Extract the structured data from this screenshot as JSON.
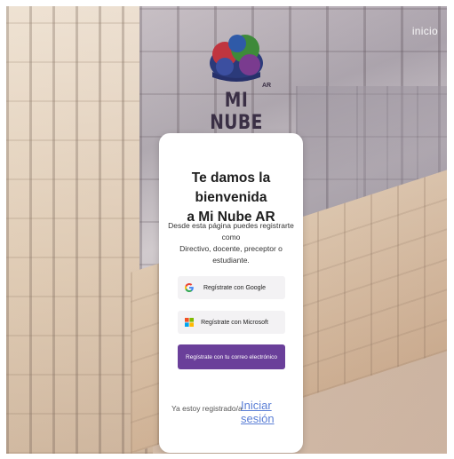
{
  "header": {
    "inicio_label": "inicio"
  },
  "logo": {
    "text": "MI NUBE",
    "sub": "AR"
  },
  "card": {
    "title_line1": "Te damos la bienvenida",
    "title_line2": "a Mi Nube AR",
    "subtitle_line1": "Desde esta página puedes registrarte como",
    "subtitle_line2": "Directivo, docente, preceptor o estudiante.",
    "google_button": "Regístrate con Google",
    "microsoft_button": "Regístrate con Microsoft",
    "email_button": "Regístrate con tu correo electrónico",
    "already_registered": "Ya estoy registrado/a",
    "login_link": "Iniciar sesión"
  },
  "icons": [
    "google-icon",
    "microsoft-icon",
    "cloud-logo-icon"
  ],
  "colors": {
    "primary": "#6a3f9a",
    "link": "#5b7fd6",
    "card_bg": "#ffffff"
  }
}
